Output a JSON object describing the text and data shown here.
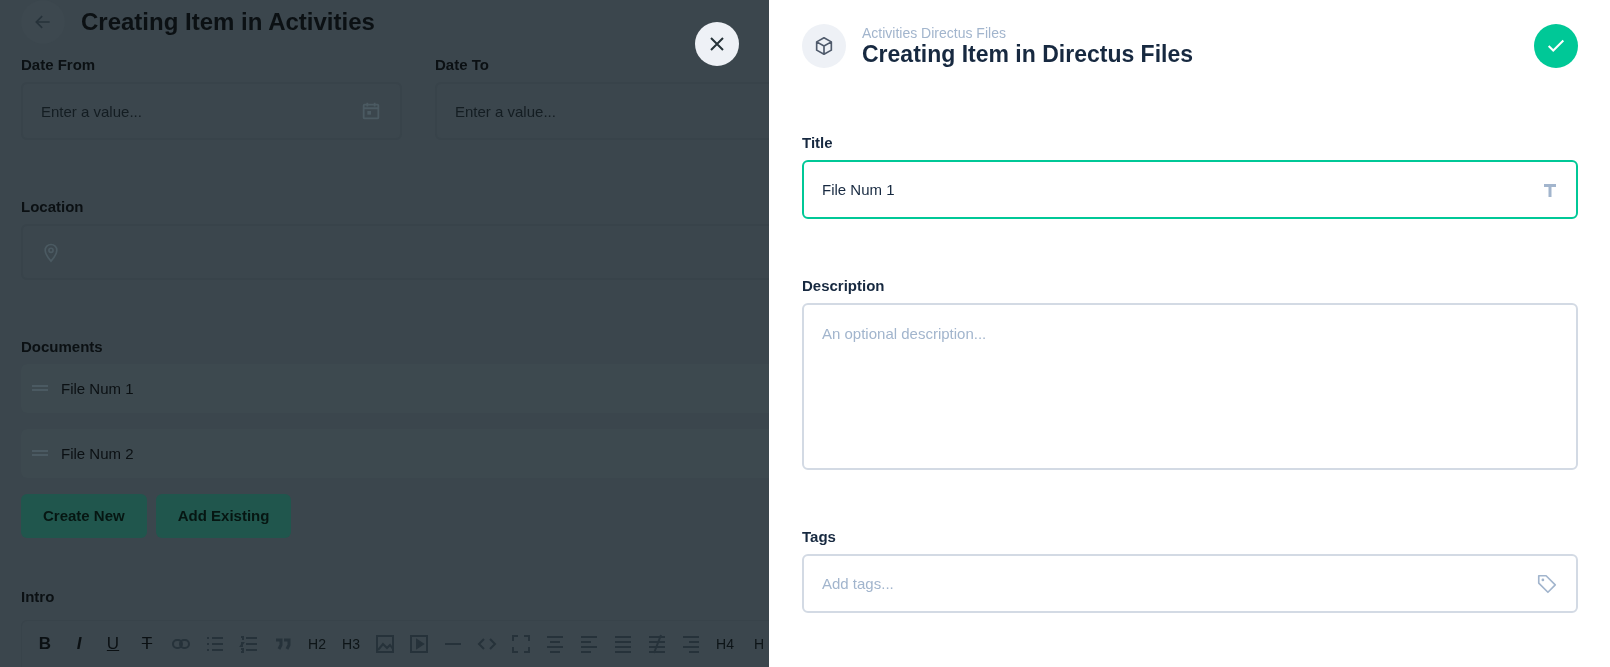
{
  "page": {
    "title": "Creating Item in Activities",
    "date_fields": [
      {
        "label": "Date From",
        "placeholder": "Enter a value...",
        "kind": "calendar"
      },
      {
        "label": "Date To",
        "placeholder": "Enter a value...",
        "kind": "plain"
      }
    ],
    "location": {
      "label": "Location"
    },
    "documents": {
      "label": "Documents",
      "items": [
        "File Num 1",
        "File Num 2"
      ],
      "buttons": [
        "Create New",
        "Add Existing"
      ]
    },
    "intro": {
      "label": "Intro",
      "toolbar": [
        {
          "kind": "text",
          "label": "B"
        },
        {
          "kind": "text",
          "label": "I"
        },
        {
          "kind": "text",
          "label": "U"
        },
        {
          "kind": "text",
          "label": "T"
        },
        {
          "kind": "link"
        },
        {
          "kind": "bullet-list"
        },
        {
          "kind": "numbered-list"
        },
        {
          "kind": "quote"
        },
        {
          "kind": "text",
          "label": "H2"
        },
        {
          "kind": "text",
          "label": "H3"
        },
        {
          "kind": "image"
        },
        {
          "kind": "video"
        },
        {
          "kind": "rule"
        },
        {
          "kind": "code"
        },
        {
          "kind": "fullscreen"
        },
        {
          "kind": "align-center"
        },
        {
          "kind": "align-left"
        },
        {
          "kind": "align-justify"
        },
        {
          "kind": "strike-lines"
        },
        {
          "kind": "align-right"
        },
        {
          "kind": "text",
          "label": "H4"
        },
        {
          "kind": "text",
          "label": "H"
        }
      ]
    }
  },
  "drawer": {
    "breadcrumb": "Activities Directus Files",
    "title": "Creating Item in Directus Files",
    "fields": [
      {
        "label": "Title",
        "kind": "input",
        "value": "File Num 1",
        "focused": true
      },
      {
        "label": "Description",
        "kind": "textarea",
        "placeholder": "An optional description..."
      },
      {
        "label": "Tags",
        "kind": "tags",
        "placeholder": "Add tags..."
      }
    ]
  }
}
